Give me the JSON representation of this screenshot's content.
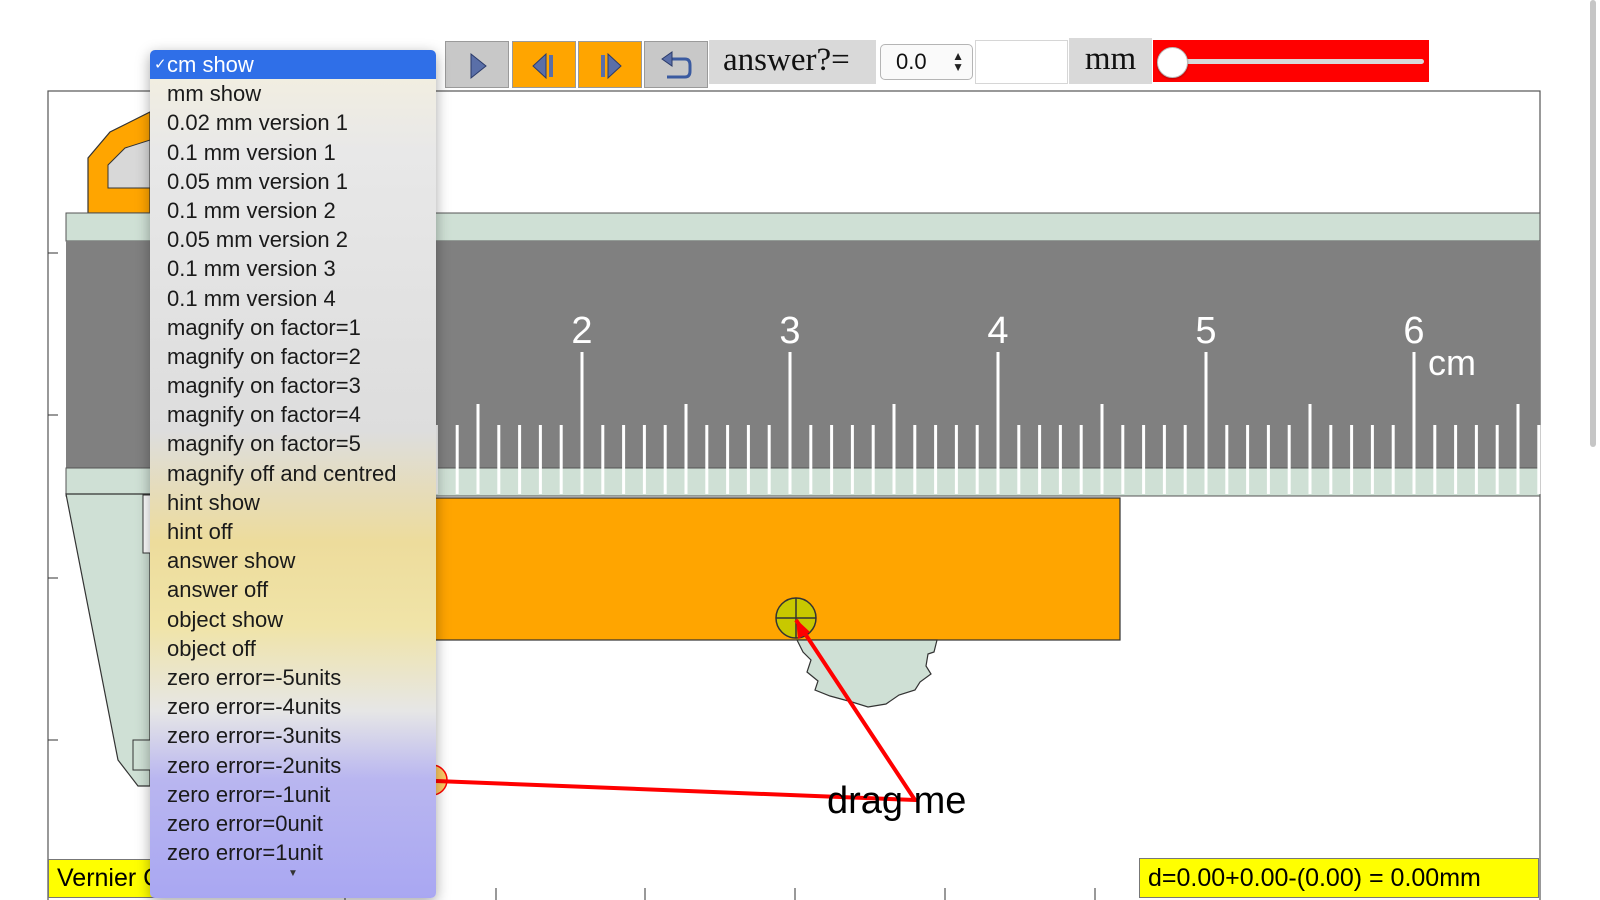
{
  "toolbar": {
    "play_icon": "play-icon",
    "step_back_icon": "step-back-icon",
    "step_forward_icon": "step-forward-icon",
    "reset_icon": "reset-icon",
    "answer_label": "answer?=",
    "answer_value": "0.0",
    "answer_input_value": "",
    "unit_label": "mm",
    "slider_value": 0,
    "slider_color": "#ff0000"
  },
  "dropdown": {
    "selected": "cm show",
    "items": [
      "cm show",
      "mm show",
      "0.02 mm version 1",
      "0.1 mm version 1",
      "0.05 mm version 1",
      "0.1 mm version 2",
      "0.05 mm version 2",
      "0.1 mm version 3",
      "0.1 mm version 4",
      "magnify on factor=1",
      "magnify on factor=2",
      "magnify on factor=3",
      "magnify on factor=4",
      "magnify on factor=5",
      "magnify off and centred",
      "hint show",
      "hint off",
      "answer show",
      "answer off",
      "object show",
      "object off",
      "zero error=-5units",
      "zero error=-4units",
      "zero error=-3units",
      "zero error=-2units",
      "zero error=-1unit",
      "zero error=0unit",
      "zero error=1unit"
    ]
  },
  "scale": {
    "labels": [
      "2",
      "3",
      "4",
      "5",
      "6"
    ],
    "unit": "cm"
  },
  "drag_label": "drag me",
  "status": {
    "title_partial": "Vernier C",
    "formula": "d=0.00+0.00-(0.00) = 0.00mm"
  },
  "colors": {
    "beam": "#808080",
    "jaw": "#cfe0d5",
    "vernier": "#ffa500",
    "status_bg": "#ffff00",
    "pointer": "#ff0000"
  }
}
